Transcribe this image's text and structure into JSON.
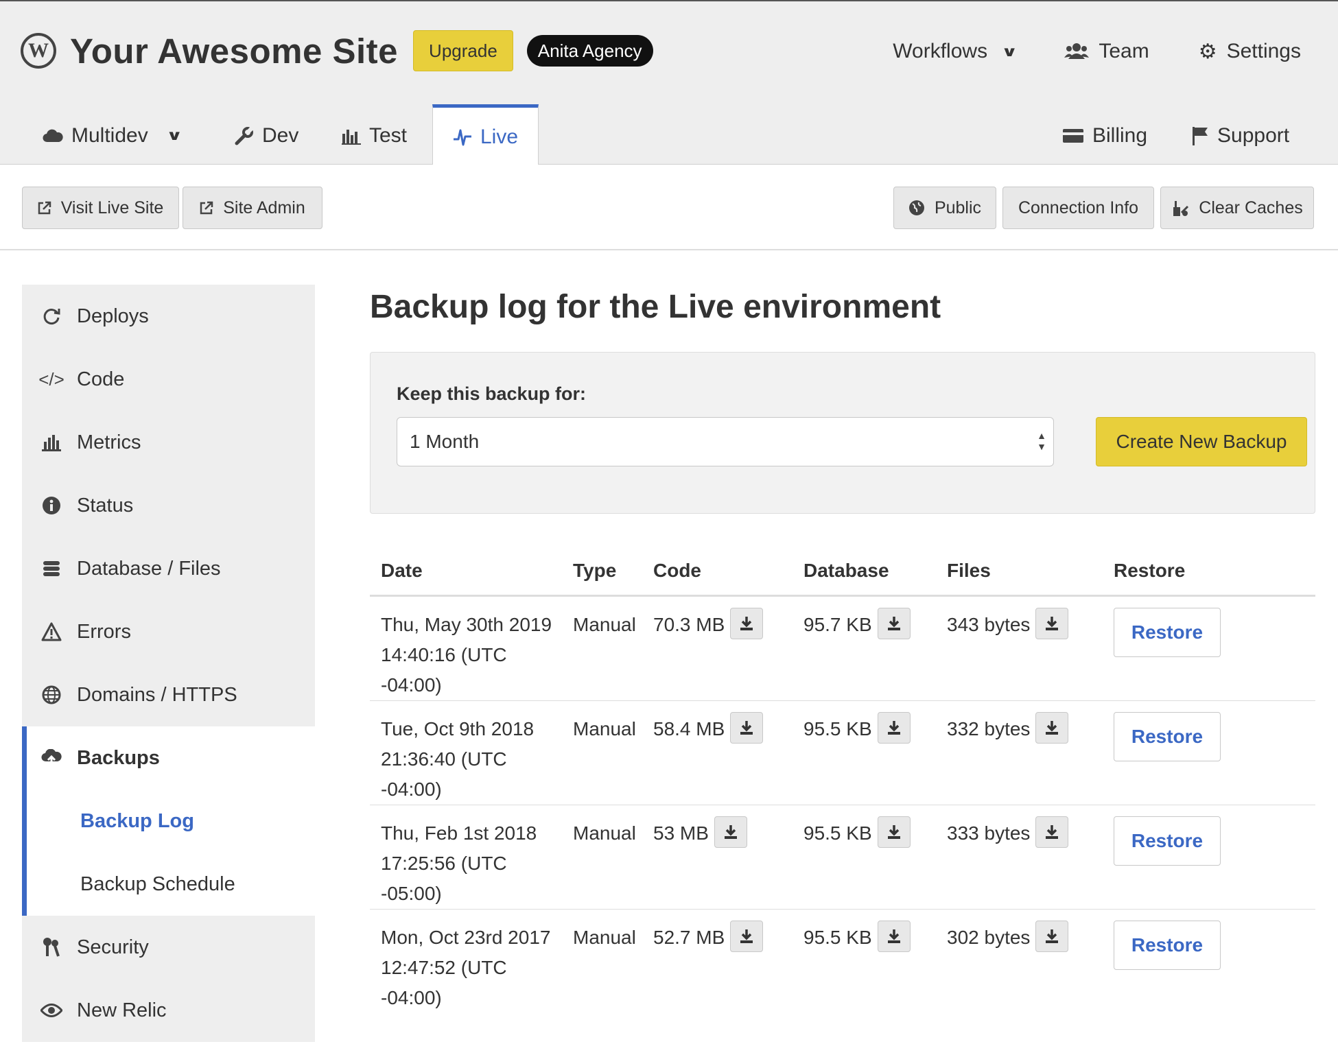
{
  "header": {
    "site_title": "Your Awesome Site",
    "upgrade_label": "Upgrade",
    "agency_label": "Anita Agency",
    "nav": {
      "workflows": "Workflows",
      "team": "Team",
      "settings": "Settings"
    }
  },
  "env_tabs": {
    "multidev": "Multidev",
    "dev": "Dev",
    "test": "Test",
    "live": "Live",
    "billing": "Billing",
    "support": "Support",
    "active": "Live"
  },
  "actions": {
    "visit_live_site": "Visit Live Site",
    "site_admin": "Site Admin",
    "public": "Public",
    "connection_info": "Connection Info",
    "clear_caches": "Clear Caches"
  },
  "sidebar": {
    "items": [
      {
        "label": "Deploys",
        "icon": "refresh-icon"
      },
      {
        "label": "Code",
        "icon": "code-icon"
      },
      {
        "label": "Metrics",
        "icon": "bar-chart-icon"
      },
      {
        "label": "Status",
        "icon": "info-icon"
      },
      {
        "label": "Database / Files",
        "icon": "database-icon"
      },
      {
        "label": "Errors",
        "icon": "warning-icon"
      },
      {
        "label": "Domains / HTTPS",
        "icon": "globe-icon"
      },
      {
        "label": "Backups",
        "icon": "cloud-upload-icon"
      },
      {
        "label": "Security",
        "icon": "keys-icon"
      },
      {
        "label": "New Relic",
        "icon": "eye-icon"
      }
    ],
    "sub_items": [
      {
        "label": "Backup Log",
        "active": true
      },
      {
        "label": "Backup Schedule",
        "active": false
      }
    ]
  },
  "main": {
    "title": "Backup log for the Live environment",
    "keep_label": "Keep this backup for:",
    "keep_value": "1 Month",
    "create_button": "Create New Backup"
  },
  "table": {
    "headers": [
      "Date",
      "Type",
      "Code",
      "Database",
      "Files",
      "Restore"
    ],
    "rows": [
      {
        "date": "Thu, May 30th 2019",
        "time": "14:40:16 (UTC -04:00)",
        "type": "Manual",
        "code": "70.3 MB",
        "database": "95.7 KB",
        "files": "343 bytes",
        "restore": "Restore"
      },
      {
        "date": "Tue, Oct 9th 2018",
        "time": "21:36:40 (UTC -04:00)",
        "type": "Manual",
        "code": "58.4 MB",
        "database": "95.5 KB",
        "files": "332 bytes",
        "restore": "Restore"
      },
      {
        "date": "Thu, Feb 1st 2018",
        "time": "17:25:56 (UTC -05:00)",
        "type": "Manual",
        "code": "53 MB",
        "database": "95.5 KB",
        "files": "333 bytes",
        "restore": "Restore"
      },
      {
        "date": "Mon, Oct 23rd 2017",
        "time": "12:47:52 (UTC -04:00)",
        "type": "Manual",
        "code": "52.7 MB",
        "database": "95.5 KB",
        "files": "302 bytes",
        "restore": "Restore"
      }
    ]
  },
  "colors": {
    "accent": "#3b68c4",
    "yellow": "#e8cf3b",
    "header_bg": "#eeeeee"
  }
}
